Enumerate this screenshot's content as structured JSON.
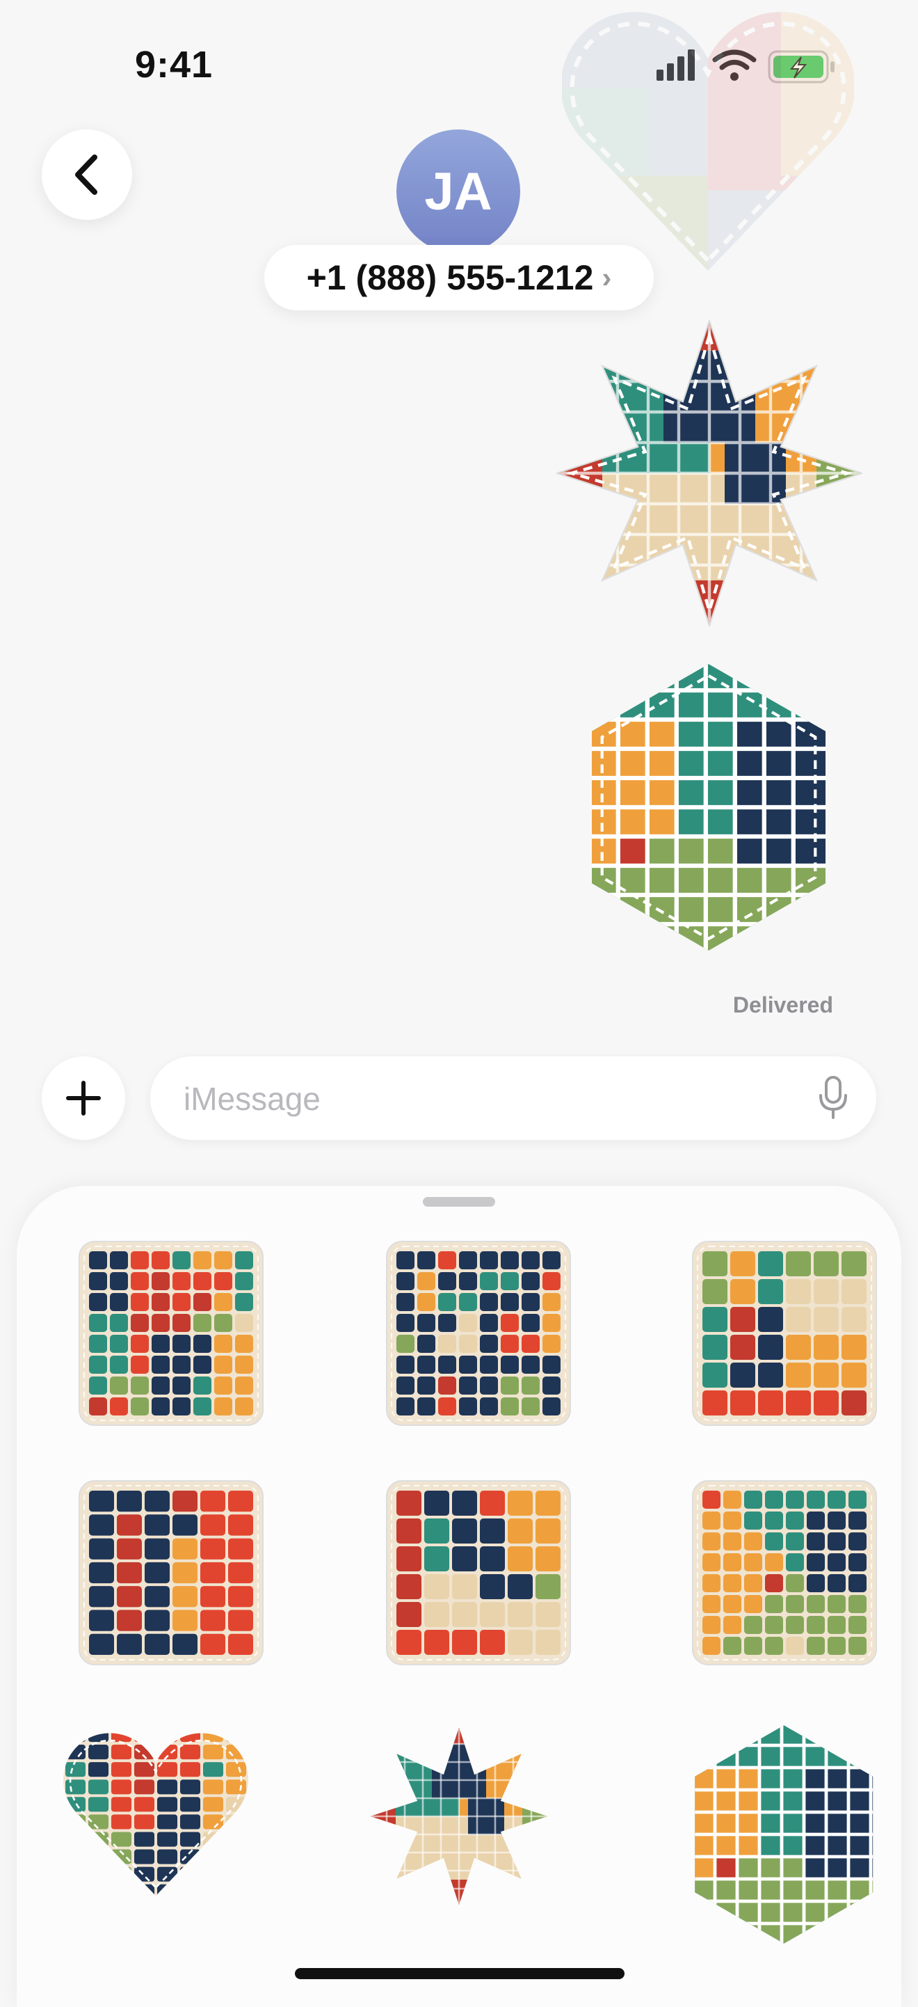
{
  "status": {
    "time": "9:41",
    "icons": [
      "signal-icon",
      "wifi-icon",
      "battery-charging-icon"
    ]
  },
  "header": {
    "back_icon": "chevron-left-icon",
    "avatar_initials": "JA",
    "contact_phone": "+1 (888) 555-1212",
    "contact_chevron": "›"
  },
  "conversation": {
    "messages": [
      {
        "type": "sticker",
        "name": "star-quilt-sticker"
      },
      {
        "type": "sticker",
        "name": "hexagon-quilt-sticker"
      }
    ],
    "status_text": "Delivered"
  },
  "composer": {
    "add_icon": "plus-icon",
    "placeholder": "iMessage",
    "mic_icon": "microphone-icon"
  },
  "sticker_drawer": {
    "stickers": [
      "square-quilt-1",
      "square-quilt-2",
      "square-quilt-3",
      "square-quilt-4",
      "square-quilt-5",
      "square-quilt-6",
      "heart-quilt",
      "star-quilt",
      "hexagon-quilt"
    ]
  },
  "colors": {
    "navy": "#1f3556",
    "teal": "#2f8f7d",
    "orange": "#efa03c",
    "red": "#e2452f",
    "darkred": "#c43a2e",
    "green": "#86a75a",
    "cream": "#e9d3ac",
    "border": "#f0e4d0"
  }
}
